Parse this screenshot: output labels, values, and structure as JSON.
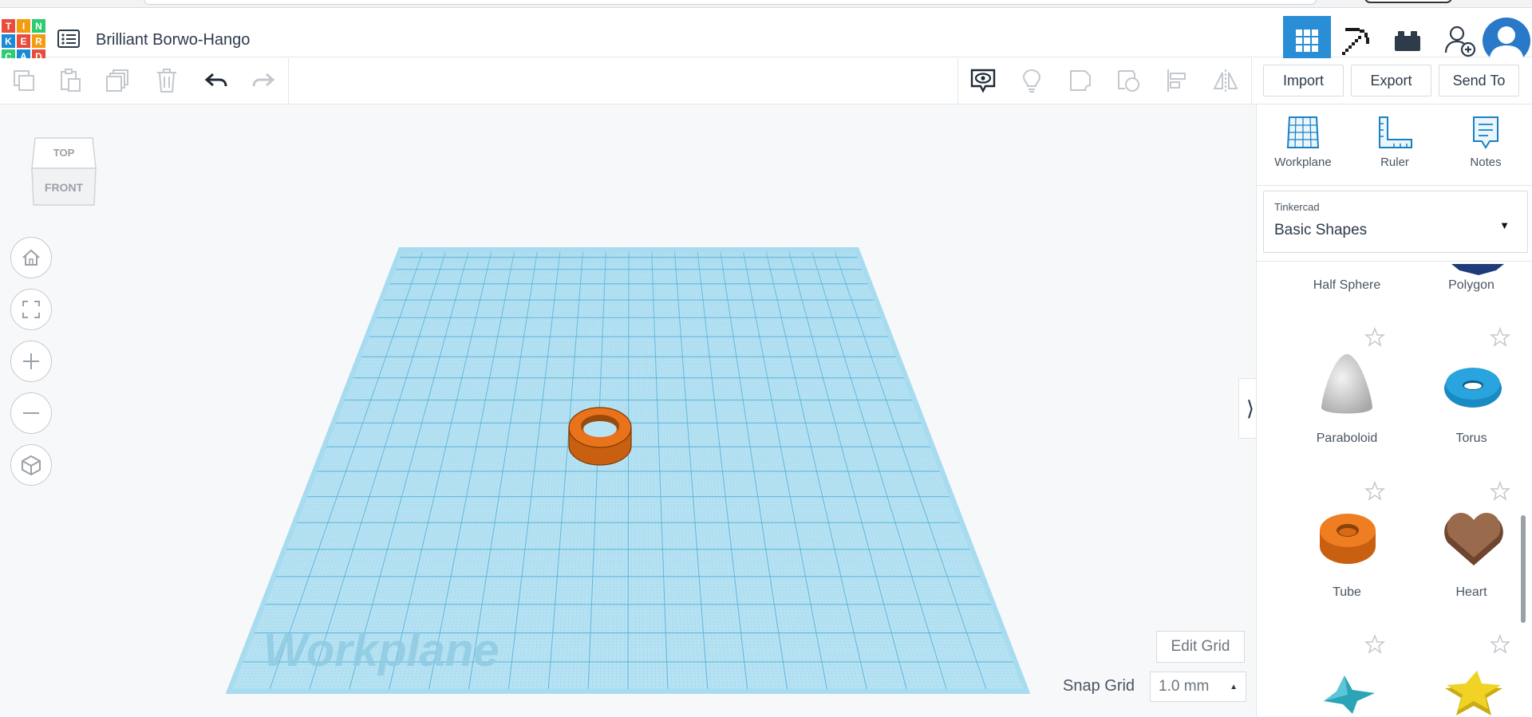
{
  "app": {
    "logo_letters": [
      "T",
      "I",
      "N",
      "K",
      "E",
      "R",
      "C",
      "A",
      "D"
    ],
    "logo_colors": [
      "#e74c3c",
      "#f39c12",
      "#2ecc71",
      "#1a8ad6",
      "#e74c3c",
      "#f39c12",
      "#2ecc71",
      "#1a8ad6",
      "#e74c3c"
    ],
    "design_title": "Brilliant Borwo-Hango",
    "accent": "#2a8ed6"
  },
  "header": {
    "views": [
      {
        "name": "3d-design-view",
        "icon": "grid-icon",
        "active": true
      },
      {
        "name": "blocks-view",
        "icon": "pickaxe-icon",
        "active": false
      },
      {
        "name": "bricks-view",
        "icon": "brick-icon",
        "active": false
      },
      {
        "name": "invite-user",
        "icon": "add-user-icon",
        "active": false
      }
    ]
  },
  "toolbar": {
    "import_label": "Import",
    "export_label": "Export",
    "send_to_label": "Send To"
  },
  "viewcube": {
    "top_label": "TOP",
    "front_label": "FRONT"
  },
  "workplane": {
    "watermark": "Workplane",
    "edit_grid_label": "Edit Grid",
    "snap_grid_label": "Snap Grid",
    "snap_grid_value": "1.0 mm",
    "grid_color": "#8fd0ea",
    "object": {
      "shape": "Tube",
      "color": "#e8731a"
    }
  },
  "panel": {
    "tools": [
      {
        "label": "Workplane",
        "icon": "workplane-icon"
      },
      {
        "label": "Ruler",
        "icon": "ruler-icon"
      },
      {
        "label": "Notes",
        "icon": "notes-icon"
      }
    ],
    "library": {
      "provider": "Tinkercad",
      "selected": "Basic Shapes"
    },
    "shapes": [
      {
        "label": "Half Sphere",
        "color": "#1f5fae"
      },
      {
        "label": "Polygon",
        "color": "#1f3b7a"
      },
      {
        "label": "Paraboloid",
        "color": "#dcdcdc"
      },
      {
        "label": "Torus",
        "color": "#1b8ac2"
      },
      {
        "label": "Tube",
        "color": "#e8731a"
      },
      {
        "label": "Heart",
        "color": "#8b5a3c"
      },
      {
        "label": "",
        "color": "#2ba4b8"
      },
      {
        "label": "",
        "color": "#e6c81f"
      }
    ]
  }
}
